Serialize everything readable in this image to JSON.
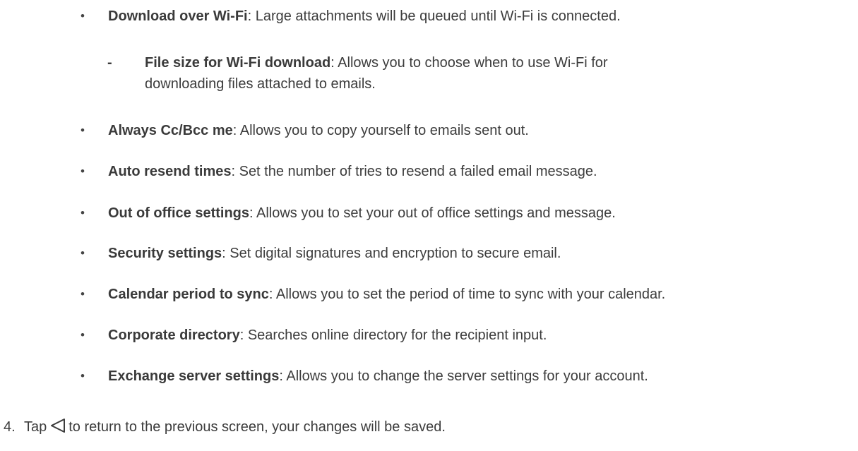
{
  "items": [
    {
      "term": "Download over Wi-Fi",
      "desc": ": Large attachments will be queued until Wi-Fi is connected."
    },
    {
      "term": "Always Cc/Bcc me",
      "desc": ": Allows you to copy yourself to emails sent out."
    },
    {
      "term": "Auto resend times",
      "desc": ": Set the number of tries to resend a failed email message."
    },
    {
      "term": "Out of office settings",
      "desc": ": Allows you to set your out of office settings and message."
    },
    {
      "term": "Security settings",
      "desc": ": Set digital signatures and encryption to secure email."
    },
    {
      "term": "Calendar period to sync",
      "desc": ": Allows you to set the period of time to sync with your calendar."
    },
    {
      "term": "Corporate directory",
      "desc": ": Searches online directory for the recipient input."
    },
    {
      "term": "Exchange server settings",
      "desc": ": Allows you to change the server settings for your account."
    }
  ],
  "bullet": "•",
  "sub_item": {
    "dash": "-",
    "term": "File size for Wi-Fi download",
    "desc_line1": ": Allows you to choose when to use Wi-Fi for",
    "desc_line2": "downloading files attached to emails."
  },
  "step": {
    "number": "4.",
    "before_icon": "Tap",
    "icon": "back-triangle-icon",
    "after_icon": "to return to the previous screen, your changes will be saved."
  }
}
